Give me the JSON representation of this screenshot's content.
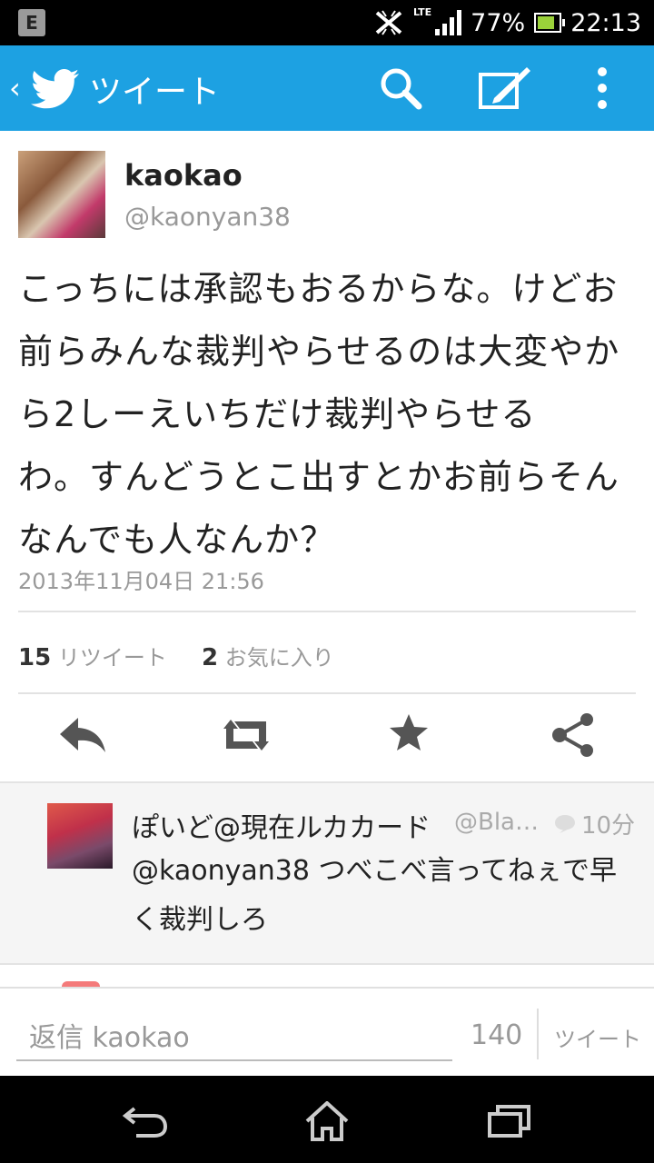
{
  "status_bar": {
    "notification_badge": "E",
    "network": "LTE",
    "battery": "77%",
    "time": "22:13"
  },
  "app_bar": {
    "title": "ツイート",
    "icons": [
      "back-chevron-icon",
      "twitter-bird-icon",
      "search-icon",
      "compose-icon",
      "overflow-menu-icon"
    ]
  },
  "tweet": {
    "name": "kaokao",
    "handle": "@kaonyan38",
    "lines": [
      "こっちには承認もおるからな。けどお",
      "前らみんな裁判やらせるのは大変やか",
      "ら2しーえいちだけ裁判やらせる",
      "わ。すんどうとこ出すとかお前らそん",
      "なんでも人なんか？"
    ],
    "date": "2013年11月04日 21:56",
    "retweet_count": "15",
    "retweet_label": "リツイート",
    "fav_count": "2",
    "fav_label": "お気に入り"
  },
  "reply": {
    "name": "ぽいど@現在ルカカード",
    "handle": "@Blac...",
    "time": "10分",
    "line1": "@kaonyan38 つべこべ言ってねぇで早",
    "line2": "く裁判しろ"
  },
  "compose": {
    "placeholder": "返信 kaokao",
    "counter": "140",
    "send": "ツイート"
  }
}
